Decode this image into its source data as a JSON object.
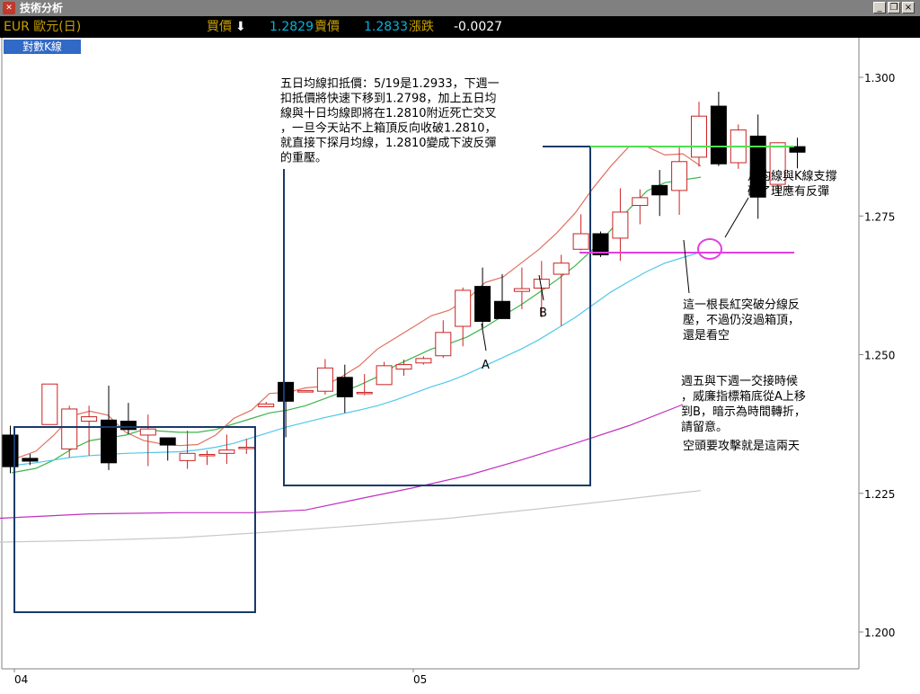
{
  "window": {
    "title": "技術分析",
    "app_icon": "chart-app-icon",
    "controls": [
      "_",
      "❐",
      "×"
    ]
  },
  "quote": {
    "symbol": "EUR 歐元(日)",
    "buy_label": "買價",
    "buy_arrow": "⬇",
    "buy_value": "1.2829",
    "sell_label": "賣價",
    "sell_value": "1.2833",
    "change_label": "漲跌",
    "change_value": "-0.0027",
    "colors": {
      "symbol": "#c8a000",
      "label": "#c8a000",
      "value": "#00b4dc",
      "change": "#ffffff"
    }
  },
  "chart_tab": {
    "label": "對數K線"
  },
  "chart_data": {
    "type": "candlestick",
    "y_ticks": [
      "1.300",
      "1.275",
      "1.250",
      "1.225",
      "1.200"
    ],
    "ylim": [
      1.1965,
      1.3085
    ],
    "x_labels": [
      "04",
      "05"
    ],
    "candles": [
      {
        "o": 1.2355,
        "h": 1.2372,
        "l": 1.2286,
        "c": 1.2298
      },
      {
        "o": 1.2313,
        "h": 1.2321,
        "l": 1.2301,
        "c": 1.2308
      },
      {
        "o": 1.2374,
        "h": 1.2438,
        "l": 1.2379,
        "c": 1.2447
      },
      {
        "o": 1.233,
        "h": 1.2408,
        "l": 1.2315,
        "c": 1.2402
      },
      {
        "o": 1.238,
        "h": 1.2408,
        "l": 1.2318,
        "c": 1.2388
      },
      {
        "o": 1.2382,
        "h": 1.2444,
        "l": 1.2292,
        "c": 1.2305
      },
      {
        "o": 1.238,
        "h": 1.2413,
        "l": 1.2357,
        "c": 1.2365
      },
      {
        "o": 1.2355,
        "h": 1.2392,
        "l": 1.2299,
        "c": 1.2366
      },
      {
        "o": 1.235,
        "h": 1.234,
        "l": 1.2309,
        "c": 1.2337
      },
      {
        "o": 1.2309,
        "h": 1.2363,
        "l": 1.2294,
        "c": 1.2322
      },
      {
        "o": 1.2318,
        "h": 1.2327,
        "l": 1.2301,
        "c": 1.232
      },
      {
        "o": 1.2322,
        "h": 1.2356,
        "l": 1.2303,
        "c": 1.2328
      },
      {
        "o": 1.2331,
        "h": 1.2348,
        "l": 1.2321,
        "c": 1.2333
      },
      {
        "o": 1.2406,
        "h": 1.2415,
        "l": 1.2411,
        "c": 1.2411
      },
      {
        "o": 1.245,
        "h": 1.2415,
        "l": 1.2351,
        "c": 1.2416
      },
      {
        "o": 1.2433,
        "h": 1.2436,
        "l": 1.2438,
        "c": 1.2435
      },
      {
        "o": 1.2434,
        "h": 1.2492,
        "l": 1.2428,
        "c": 1.2476
      },
      {
        "o": 1.2459,
        "h": 1.2482,
        "l": 1.2395,
        "c": 1.2424
      },
      {
        "o": 1.243,
        "h": 1.2465,
        "l": 1.2427,
        "c": 1.2432
      },
      {
        "o": 1.2446,
        "h": 1.2487,
        "l": 1.2451,
        "c": 1.248
      },
      {
        "o": 1.2474,
        "h": 1.2491,
        "l": 1.2462,
        "c": 1.2482
      },
      {
        "o": 1.2485,
        "h": 1.2497,
        "l": 1.2482,
        "c": 1.2493
      },
      {
        "o": 1.2498,
        "h": 1.2562,
        "l": 1.2494,
        "c": 1.254
      },
      {
        "o": 1.2551,
        "h": 1.2621,
        "l": 1.2515,
        "c": 1.2616
      },
      {
        "o": 1.2623,
        "h": 1.2657,
        "l": 1.2549,
        "c": 1.256
      },
      {
        "o": 1.2596,
        "h": 1.2645,
        "l": 1.258,
        "c": 1.2565
      },
      {
        "o": 1.2614,
        "h": 1.2657,
        "l": 1.2582,
        "c": 1.2619
      },
      {
        "o": 1.262,
        "h": 1.2669,
        "l": 1.2567,
        "c": 1.2636
      },
      {
        "o": 1.2645,
        "h": 1.268,
        "l": 1.2552,
        "c": 1.2665
      },
      {
        "o": 1.269,
        "h": 1.2753,
        "l": 1.2688,
        "c": 1.2718
      },
      {
        "o": 1.2718,
        "h": 1.2722,
        "l": 1.2676,
        "c": 1.268
      },
      {
        "o": 1.271,
        "h": 1.28,
        "l": 1.2669,
        "c": 1.2757
      },
      {
        "o": 1.2769,
        "h": 1.2798,
        "l": 1.2735,
        "c": 1.2783
      },
      {
        "o": 1.2805,
        "h": 1.2833,
        "l": 1.275,
        "c": 1.2788
      },
      {
        "o": 1.2796,
        "h": 1.2877,
        "l": 1.2752,
        "c": 1.2848
      },
      {
        "o": 1.2856,
        "h": 1.2956,
        "l": 1.2839,
        "c": 1.293
      },
      {
        "o": 1.2948,
        "h": 1.2974,
        "l": 1.284,
        "c": 1.2844
      },
      {
        "o": 1.2846,
        "h": 1.2915,
        "l": 1.2835,
        "c": 1.2905
      },
      {
        "o": 1.2894,
        "h": 1.2933,
        "l": 1.2745,
        "c": 1.2784
      },
      {
        "o": 1.2807,
        "h": 1.2883,
        "l": 1.2792,
        "c": 1.2882
      },
      {
        "o": 1.2875,
        "h": 1.2891,
        "l": 1.2836,
        "c": 1.2865
      }
    ],
    "ma_series": [
      {
        "key": "ma5",
        "color": "#e07060",
        "points": [
          [
            13,
            1.231
          ],
          [
            40,
            1.2326
          ],
          [
            60,
            1.2355
          ],
          [
            80,
            1.239
          ],
          [
            100,
            1.2398
          ],
          [
            120,
            1.2391
          ],
          [
            140,
            1.236
          ],
          [
            160,
            1.2345
          ],
          [
            180,
            1.2339
          ],
          [
            200,
            1.2336
          ],
          [
            220,
            1.2338
          ],
          [
            240,
            1.2355
          ],
          [
            260,
            1.2385
          ],
          [
            280,
            1.24
          ],
          [
            300,
            1.243
          ],
          [
            320,
            1.2432
          ],
          [
            340,
            1.244
          ],
          [
            360,
            1.2443
          ],
          [
            380,
            1.246
          ],
          [
            400,
            1.248
          ],
          [
            420,
            1.251
          ],
          [
            440,
            1.253
          ],
          [
            460,
            1.255
          ],
          [
            480,
            1.257
          ],
          [
            500,
            1.258
          ],
          [
            520,
            1.26
          ],
          [
            540,
            1.263
          ],
          [
            560,
            1.264
          ],
          [
            580,
            1.2665
          ],
          [
            600,
            1.269
          ],
          [
            620,
            1.272
          ],
          [
            640,
            1.2755
          ],
          [
            660,
            1.28
          ],
          [
            680,
            1.284
          ],
          [
            700,
            1.2875
          ],
          [
            720,
            1.2875
          ],
          [
            740,
            1.286
          ],
          [
            760,
            1.2862
          ],
          [
            780,
            1.284
          ]
        ]
      },
      {
        "key": "ma10",
        "color": "#3cb44b",
        "points": [
          [
            13,
            1.2287
          ],
          [
            40,
            1.2295
          ],
          [
            60,
            1.231
          ],
          [
            80,
            1.233
          ],
          [
            100,
            1.2345
          ],
          [
            120,
            1.235
          ],
          [
            140,
            1.2355
          ],
          [
            160,
            1.2365
          ],
          [
            180,
            1.2362
          ],
          [
            200,
            1.236
          ],
          [
            220,
            1.236
          ],
          [
            240,
            1.2365
          ],
          [
            260,
            1.2375
          ],
          [
            280,
            1.2385
          ],
          [
            300,
            1.2395
          ],
          [
            320,
            1.24
          ],
          [
            340,
            1.2408
          ],
          [
            360,
            1.242
          ],
          [
            380,
            1.2432
          ],
          [
            400,
            1.2445
          ],
          [
            420,
            1.246
          ],
          [
            440,
            1.248
          ],
          [
            460,
            1.2495
          ],
          [
            480,
            1.251
          ],
          [
            500,
            1.252
          ],
          [
            520,
            1.2532
          ],
          [
            540,
            1.255
          ],
          [
            560,
            1.257
          ],
          [
            580,
            1.259
          ],
          [
            600,
            1.2612
          ],
          [
            620,
            1.2635
          ],
          [
            640,
            1.266
          ],
          [
            660,
            1.269
          ],
          [
            680,
            1.2725
          ],
          [
            700,
            1.2762
          ],
          [
            720,
            1.2795
          ],
          [
            740,
            1.281
          ],
          [
            760,
            1.2815
          ],
          [
            780,
            1.282
          ]
        ]
      },
      {
        "key": "ma20",
        "color": "#50c8e8",
        "points": [
          [
            13,
            1.23
          ],
          [
            40,
            1.2305
          ],
          [
            60,
            1.231
          ],
          [
            80,
            1.2315
          ],
          [
            100,
            1.2318
          ],
          [
            120,
            1.232
          ],
          [
            140,
            1.2322
          ],
          [
            160,
            1.2323
          ],
          [
            180,
            1.2324
          ],
          [
            200,
            1.2325
          ],
          [
            220,
            1.2328
          ],
          [
            240,
            1.2333
          ],
          [
            260,
            1.234
          ],
          [
            280,
            1.235
          ],
          [
            300,
            1.236
          ],
          [
            320,
            1.237
          ],
          [
            340,
            1.2378
          ],
          [
            360,
            1.2386
          ],
          [
            380,
            1.2393
          ],
          [
            400,
            1.24
          ],
          [
            420,
            1.2408
          ],
          [
            440,
            1.2418
          ],
          [
            460,
            1.243
          ],
          [
            480,
            1.2442
          ],
          [
            500,
            1.2452
          ],
          [
            520,
            1.2465
          ],
          [
            540,
            1.248
          ],
          [
            560,
            1.2495
          ],
          [
            580,
            1.251
          ],
          [
            600,
            1.2527
          ],
          [
            620,
            1.2547
          ],
          [
            640,
            1.2567
          ],
          [
            660,
            1.259
          ],
          [
            680,
            1.2613
          ],
          [
            700,
            1.2632
          ],
          [
            720,
            1.265
          ],
          [
            740,
            1.2665
          ],
          [
            760,
            1.2675
          ],
          [
            780,
            1.2685
          ]
        ]
      },
      {
        "key": "ma60",
        "color": "#c030c0",
        "points": [
          [
            0,
            1.2205
          ],
          [
            100,
            1.2213
          ],
          [
            200,
            1.2215
          ],
          [
            280,
            1.2215
          ],
          [
            340,
            1.222
          ],
          [
            400,
            1.224
          ],
          [
            460,
            1.226
          ],
          [
            520,
            1.2282
          ],
          [
            580,
            1.231
          ],
          [
            640,
            1.234
          ],
          [
            700,
            1.2372
          ],
          [
            760,
            1.241
          ]
        ]
      },
      {
        "key": "ma120",
        "color": "#c8c8c8",
        "points": [
          [
            0,
            1.2162
          ],
          [
            100,
            1.2165
          ],
          [
            200,
            1.217
          ],
          [
            300,
            1.218
          ],
          [
            400,
            1.2192
          ],
          [
            500,
            1.2205
          ],
          [
            600,
            1.2222
          ],
          [
            700,
            1.224
          ],
          [
            780,
            1.2255
          ]
        ]
      }
    ],
    "annotations": {
      "note_top": [
        "五日均線扣抵價：5/19是1.2933，下週一",
        "扣抵價將快速下移到1.2798，加上五日均",
        "線與十日均線即將在1.2810附近死亡交叉",
        "，一旦今天站不上箱頂反向收破1.2810，",
        "就直接下探月均線，1.2810變成下波反彈",
        "的重壓。"
      ],
      "note_right1": [
        "月均線與K線支撐",
        "破了理應有反彈"
      ],
      "note_right2": [
        "這一根長紅突破分線反",
        "壓，不過仍沒過箱頂，",
        "還是看空"
      ],
      "note_right3": [
        "週五與下週一交接時候",
        "，威廉指標箱底從A上移",
        "到B，暗示為時間轉折，",
        "請留意。"
      ],
      "note_right4": "空頭要攻擊就是這兩天",
      "label_a": "A",
      "label_b": "B"
    }
  }
}
